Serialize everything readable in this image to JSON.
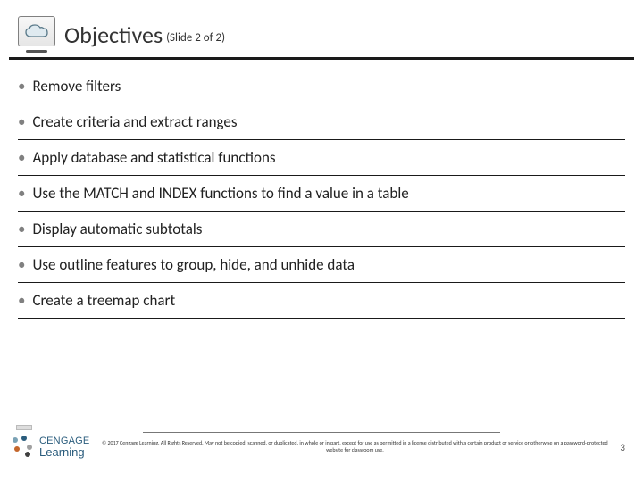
{
  "header": {
    "title": "Objectives",
    "subtitle": "(Slide 2 of 2)"
  },
  "bullets": [
    "Remove filters",
    "Create criteria and extract ranges",
    "Apply database and statistical functions",
    "Use the MATCH and INDEX functions to find a value in a table",
    "Display automatic subtotals",
    "Use outline features to group, hide, and unhide data",
    "Create a treemap chart"
  ],
  "footer": {
    "logo_line1": "CENGAGE",
    "logo_line2": "Learning",
    "copyright": "© 2017 Cengage Learning. All Rights Reserved. May not be copied, scanned, or duplicated, in whole or in part, except for use as permitted in a license distributed with a certain product or service or otherwise on a password-protected website for classroom use.",
    "page": "3"
  }
}
